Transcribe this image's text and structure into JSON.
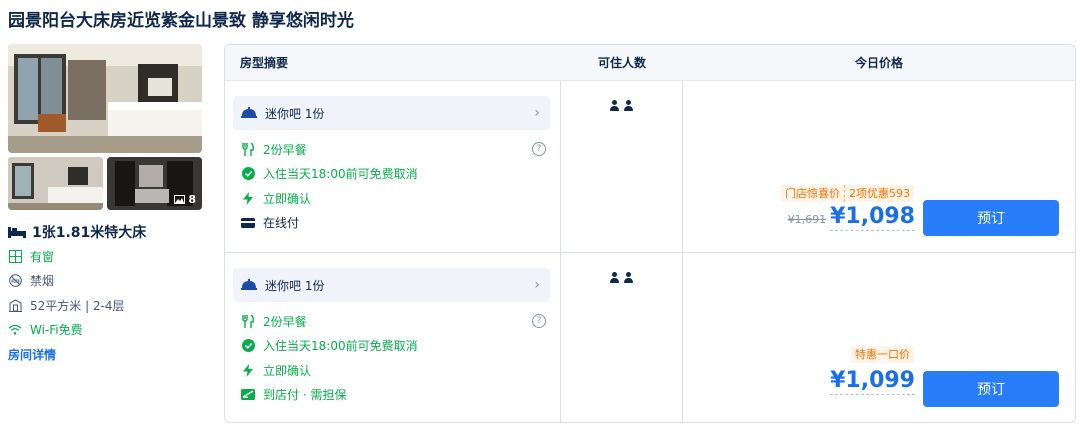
{
  "title": "园景阳台大床房近览紫金山景致 静享悠闲时光",
  "room": {
    "photo_count": "8",
    "bed": "1张1.81米特大床",
    "features": [
      {
        "icon": "window-icon",
        "text": "有窗",
        "color": "#06ae4b"
      },
      {
        "icon": "no-smoking-icon",
        "text": "禁烟",
        "color": "#455873"
      },
      {
        "icon": "area-icon",
        "text": "52平方米 | 2-4层",
        "color": "#455873"
      },
      {
        "icon": "wifi-icon",
        "text": "Wi-Fi免费",
        "color": "#06ae4b"
      }
    ],
    "details_link": "房间详情"
  },
  "table": {
    "headers": {
      "summary": "房型摘要",
      "occupancy": "可住人数",
      "price": "今日价格"
    },
    "rows": [
      {
        "minibar": "迷你吧 1份",
        "items": [
          {
            "icon": "breakfast-icon",
            "text": "2份早餐",
            "has_help": true
          },
          {
            "icon": "check-circle-icon",
            "text": "入住当天18:00前可免费取消"
          },
          {
            "icon": "lightning-icon",
            "text": "立即确认"
          },
          {
            "icon": "card-icon",
            "text": "在线付"
          }
        ],
        "promos": [
          "门店惊喜价",
          "2项优惠593"
        ],
        "original_price": "¥1,691",
        "price": "¥1,098",
        "button": "预订"
      },
      {
        "minibar": "迷你吧 1份",
        "items": [
          {
            "icon": "breakfast-icon",
            "text": "2份早餐",
            "has_help": true
          },
          {
            "icon": "check-circle-icon",
            "text": "入住当天18:00前可免费取消"
          },
          {
            "icon": "lightning-icon",
            "text": "立即确认"
          },
          {
            "icon": "pay-at-hotel-icon",
            "text": "到店付 · 需担保"
          }
        ],
        "promos": [
          "特惠一口价"
        ],
        "original_price": "",
        "price": "¥1,099",
        "button": "预订"
      }
    ]
  },
  "colors": {
    "accent": "#287dfa",
    "price": "#1a6fe8",
    "green": "#06ae4b",
    "promo": "#ff6f00"
  }
}
